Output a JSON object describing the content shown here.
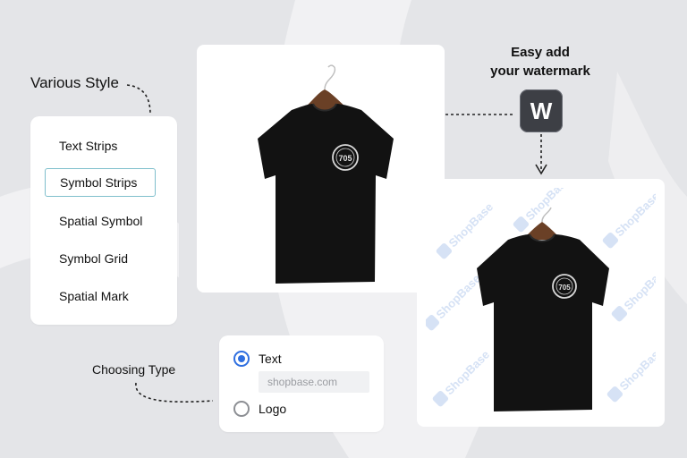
{
  "labels": {
    "various_style": "Various Style",
    "easy_add_line1": "Easy add",
    "easy_add_line2": "your watermark",
    "choosing_type": "Choosing Type"
  },
  "style_options": [
    {
      "label": "Text Strips",
      "selected": false
    },
    {
      "label": "Symbol Strips",
      "selected": true
    },
    {
      "label": "Spatial Symbol",
      "selected": false
    },
    {
      "label": "Symbol Grid",
      "selected": false
    },
    {
      "label": "Spatial Mark",
      "selected": false
    }
  ],
  "type_selector": {
    "text_option": "Text",
    "text_placeholder": "shopbase.com",
    "logo_option": "Logo",
    "selected": "Text"
  },
  "watermark_badge": "W",
  "watermark_text": "ShopBase",
  "shirt_print": "705",
  "colors": {
    "background": "#e4e5e8",
    "radio_accent": "#2f6fe0",
    "selected_border": "#7fbfcc",
    "badge_bg": "#3d3f45",
    "watermark": "#d6e2f5"
  },
  "icons": [
    "hanger-icon",
    "tshirt-icon",
    "watermark-w-icon",
    "shopbase-check-icon"
  ]
}
